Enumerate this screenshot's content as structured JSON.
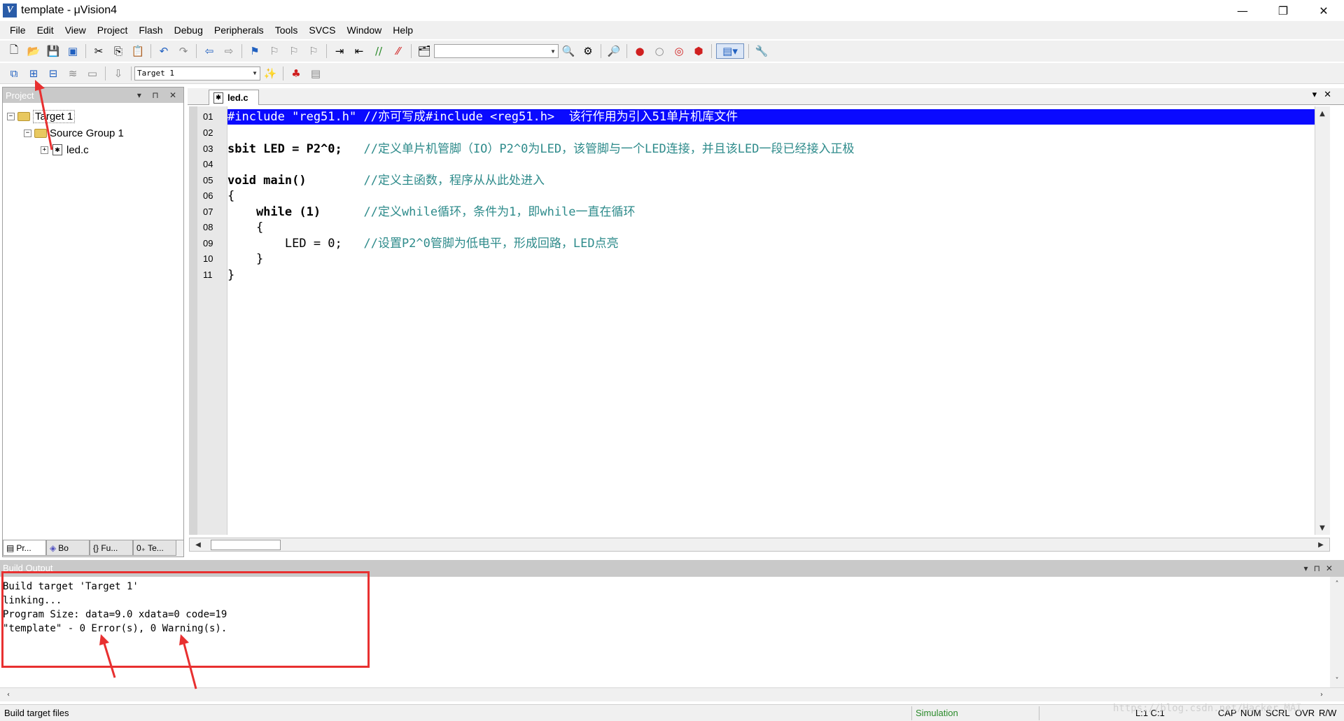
{
  "window": {
    "title": "template - μVision4",
    "minimize": "—",
    "restore": "❐",
    "close": "✕"
  },
  "menu": [
    "File",
    "Edit",
    "View",
    "Project",
    "Flash",
    "Debug",
    "Peripherals",
    "Tools",
    "SVCS",
    "Window",
    "Help"
  ],
  "toolbar2": {
    "target_select": "Target 1"
  },
  "project_panel": {
    "title": "Project",
    "controls": "▾ ⊓ ✕",
    "tree": {
      "target": "Target 1",
      "group": "Source Group 1",
      "file": "led.c"
    },
    "tabs": [
      "Pr...",
      "Bo",
      "{} Fu...",
      "0₊ Te..."
    ]
  },
  "editor": {
    "tab": "led.c",
    "controls": "▾✕",
    "line_numbers": [
      "01",
      "02",
      "03",
      "04",
      "05",
      "06",
      "07",
      "08",
      "09",
      "10",
      "11"
    ],
    "lines": [
      {
        "code": "#include \"reg51.h\" ",
        "comment": "//亦可写成#include <reg51.h>  该行作用为引入51单片机库文件",
        "highlight": true
      },
      {
        "code": "",
        "comment": ""
      },
      {
        "code": "sbit LED = P2^0;   ",
        "comment": "//定义单片机管脚（IO）P2^0为LED，该管脚与一个LED连接，并且该LED一段已经接入正极"
      },
      {
        "code": "",
        "comment": ""
      },
      {
        "code": "void main()        ",
        "comment": "//定义主函数，程序从从此处进入"
      },
      {
        "code": "{",
        "comment": ""
      },
      {
        "code": "    while (1)      ",
        "comment": "//定义while循环，条件为1，即while一直在循环"
      },
      {
        "code": "    {",
        "comment": ""
      },
      {
        "code": "        LED = 0;   ",
        "comment": "//设置P2^0管脚为低电平，形成回路，LED点亮"
      },
      {
        "code": "    }",
        "comment": ""
      },
      {
        "code": "}",
        "comment": ""
      }
    ]
  },
  "build_output": {
    "title": "Build Output",
    "lines": [
      "Build target 'Target 1'",
      "linking...",
      "Program Size: data=9.0 xdata=0 code=19",
      "\"template\" - 0 Error(s), 0 Warning(s)."
    ]
  },
  "status": {
    "left": "Build target files",
    "mode": "Simulation",
    "position": "L:1 C:1",
    "cap": "CAP",
    "num": "NUM",
    "scrl": "SCRL",
    "ovr": "OVR",
    "rw": "R/W",
    "watermark": "https://blog.csdn.net/Hacker_MAI"
  },
  "colors": {
    "annotation": "#e83030",
    "highlight": "#0a0aff",
    "comment": "#2e8b8b"
  }
}
